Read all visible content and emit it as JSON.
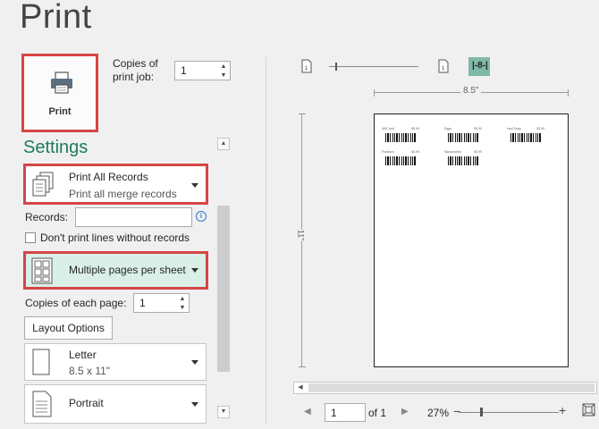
{
  "page": {
    "title": "Print"
  },
  "print_button": {
    "label": "Print"
  },
  "copies_job": {
    "label_line1": "Copies of",
    "label_line2": "print job:",
    "value": "1"
  },
  "settings": {
    "heading": "Settings",
    "records_dropdown": {
      "title": "Print All Records",
      "subtitle": "Print all merge records"
    },
    "records_label": "Records:",
    "records_value": "",
    "dont_print_lines": "Don't print lines without records",
    "pages_dropdown": {
      "title": "Multiple pages per sheet"
    },
    "copies_each": {
      "label": "Copies of each page:",
      "value": "1"
    },
    "layout_options": "Layout Options",
    "paper_dropdown": {
      "title": "Letter",
      "subtitle": "8.5 x 11\""
    },
    "orientation_dropdown": {
      "title": "Portrait"
    }
  },
  "preview": {
    "width_label": "8.5\"",
    "height_label": "11\"",
    "labels": [
      {
        "left": "ABC Ipsf",
        "right": "$5.99"
      },
      {
        "left": "Eggs",
        "right": "$3.99"
      },
      {
        "left": "Iced Soap",
        "right": "$3.99"
      },
      {
        "left": "Potatoes",
        "right": "$4.99"
      },
      {
        "left": "Sandwiches",
        "right": "$3.99"
      }
    ],
    "page_number": "1",
    "of_label": "of 1",
    "zoom": "27%",
    "zoom_minus": "−",
    "zoom_plus": "+",
    "view_8_label": "8"
  },
  "colors": {
    "highlight_border": "#d64545",
    "accent_green": "#1e7b5c",
    "selected_bg": "#d9efe8"
  }
}
